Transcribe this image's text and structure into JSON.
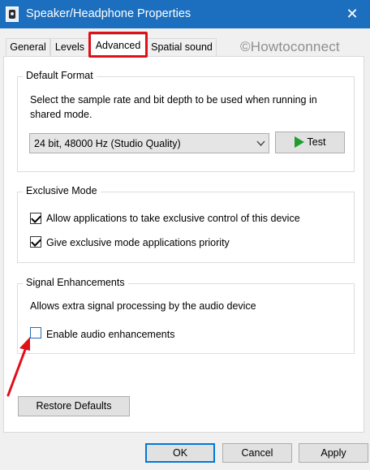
{
  "window": {
    "title": "Speaker/Headphone Properties",
    "close_glyph": "✕",
    "icon": "speaker-icon"
  },
  "watermark": "©Howtoconnect",
  "tabs": [
    {
      "label": "General",
      "active": false
    },
    {
      "label": "Levels",
      "active": false
    },
    {
      "label": "Advanced",
      "active": true
    },
    {
      "label": "Spatial sound",
      "active": false
    }
  ],
  "default_format": {
    "title": "Default Format",
    "description": "Select the sample rate and bit depth to be used when running in shared mode.",
    "selected_format": "24 bit, 48000 Hz (Studio Quality)",
    "test_label": "Test"
  },
  "exclusive_mode": {
    "title": "Exclusive Mode",
    "options": [
      {
        "label": "Allow applications to take exclusive control of this device",
        "checked": true
      },
      {
        "label": "Give exclusive mode applications priority",
        "checked": true
      }
    ]
  },
  "signal_enhancements": {
    "title": "Signal Enhancements",
    "description": "Allows extra signal processing by the audio device",
    "option": {
      "label": "Enable audio enhancements",
      "checked": false
    }
  },
  "buttons": {
    "restore_defaults": "Restore Defaults",
    "ok": "OK",
    "cancel": "Cancel",
    "apply": "Apply"
  },
  "colors": {
    "titlebar": "#1c6fbe",
    "highlight": "#e0101a",
    "test_play": "#1e9e2e",
    "default_button_border": "#0078d7"
  }
}
